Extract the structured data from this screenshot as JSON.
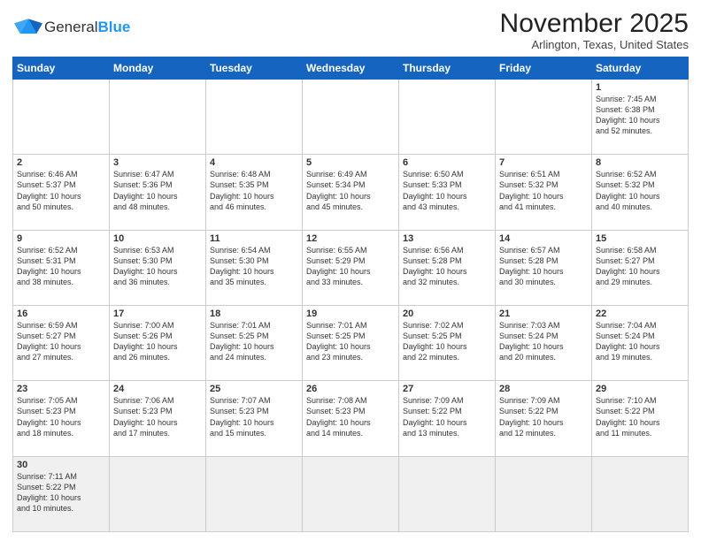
{
  "header": {
    "logo_general": "General",
    "logo_blue": "Blue",
    "title": "November 2025",
    "subtitle": "Arlington, Texas, United States"
  },
  "weekdays": [
    "Sunday",
    "Monday",
    "Tuesday",
    "Wednesday",
    "Thursday",
    "Friday",
    "Saturday"
  ],
  "weeks": [
    [
      {
        "day": "",
        "info": ""
      },
      {
        "day": "",
        "info": ""
      },
      {
        "day": "",
        "info": ""
      },
      {
        "day": "",
        "info": ""
      },
      {
        "day": "",
        "info": ""
      },
      {
        "day": "",
        "info": ""
      },
      {
        "day": "1",
        "info": "Sunrise: 7:45 AM\nSunset: 6:38 PM\nDaylight: 10 hours\nand 52 minutes."
      }
    ],
    [
      {
        "day": "2",
        "info": "Sunrise: 6:46 AM\nSunset: 5:37 PM\nDaylight: 10 hours\nand 50 minutes."
      },
      {
        "day": "3",
        "info": "Sunrise: 6:47 AM\nSunset: 5:36 PM\nDaylight: 10 hours\nand 48 minutes."
      },
      {
        "day": "4",
        "info": "Sunrise: 6:48 AM\nSunset: 5:35 PM\nDaylight: 10 hours\nand 46 minutes."
      },
      {
        "day": "5",
        "info": "Sunrise: 6:49 AM\nSunset: 5:34 PM\nDaylight: 10 hours\nand 45 minutes."
      },
      {
        "day": "6",
        "info": "Sunrise: 6:50 AM\nSunset: 5:33 PM\nDaylight: 10 hours\nand 43 minutes."
      },
      {
        "day": "7",
        "info": "Sunrise: 6:51 AM\nSunset: 5:32 PM\nDaylight: 10 hours\nand 41 minutes."
      },
      {
        "day": "8",
        "info": "Sunrise: 6:52 AM\nSunset: 5:32 PM\nDaylight: 10 hours\nand 40 minutes."
      }
    ],
    [
      {
        "day": "9",
        "info": "Sunrise: 6:52 AM\nSunset: 5:31 PM\nDaylight: 10 hours\nand 38 minutes."
      },
      {
        "day": "10",
        "info": "Sunrise: 6:53 AM\nSunset: 5:30 PM\nDaylight: 10 hours\nand 36 minutes."
      },
      {
        "day": "11",
        "info": "Sunrise: 6:54 AM\nSunset: 5:30 PM\nDaylight: 10 hours\nand 35 minutes."
      },
      {
        "day": "12",
        "info": "Sunrise: 6:55 AM\nSunset: 5:29 PM\nDaylight: 10 hours\nand 33 minutes."
      },
      {
        "day": "13",
        "info": "Sunrise: 6:56 AM\nSunset: 5:28 PM\nDaylight: 10 hours\nand 32 minutes."
      },
      {
        "day": "14",
        "info": "Sunrise: 6:57 AM\nSunset: 5:28 PM\nDaylight: 10 hours\nand 30 minutes."
      },
      {
        "day": "15",
        "info": "Sunrise: 6:58 AM\nSunset: 5:27 PM\nDaylight: 10 hours\nand 29 minutes."
      }
    ],
    [
      {
        "day": "16",
        "info": "Sunrise: 6:59 AM\nSunset: 5:27 PM\nDaylight: 10 hours\nand 27 minutes."
      },
      {
        "day": "17",
        "info": "Sunrise: 7:00 AM\nSunset: 5:26 PM\nDaylight: 10 hours\nand 26 minutes."
      },
      {
        "day": "18",
        "info": "Sunrise: 7:01 AM\nSunset: 5:25 PM\nDaylight: 10 hours\nand 24 minutes."
      },
      {
        "day": "19",
        "info": "Sunrise: 7:01 AM\nSunset: 5:25 PM\nDaylight: 10 hours\nand 23 minutes."
      },
      {
        "day": "20",
        "info": "Sunrise: 7:02 AM\nSunset: 5:25 PM\nDaylight: 10 hours\nand 22 minutes."
      },
      {
        "day": "21",
        "info": "Sunrise: 7:03 AM\nSunset: 5:24 PM\nDaylight: 10 hours\nand 20 minutes."
      },
      {
        "day": "22",
        "info": "Sunrise: 7:04 AM\nSunset: 5:24 PM\nDaylight: 10 hours\nand 19 minutes."
      }
    ],
    [
      {
        "day": "23",
        "info": "Sunrise: 7:05 AM\nSunset: 5:23 PM\nDaylight: 10 hours\nand 18 minutes."
      },
      {
        "day": "24",
        "info": "Sunrise: 7:06 AM\nSunset: 5:23 PM\nDaylight: 10 hours\nand 17 minutes."
      },
      {
        "day": "25",
        "info": "Sunrise: 7:07 AM\nSunset: 5:23 PM\nDaylight: 10 hours\nand 15 minutes."
      },
      {
        "day": "26",
        "info": "Sunrise: 7:08 AM\nSunset: 5:23 PM\nDaylight: 10 hours\nand 14 minutes."
      },
      {
        "day": "27",
        "info": "Sunrise: 7:09 AM\nSunset: 5:22 PM\nDaylight: 10 hours\nand 13 minutes."
      },
      {
        "day": "28",
        "info": "Sunrise: 7:09 AM\nSunset: 5:22 PM\nDaylight: 10 hours\nand 12 minutes."
      },
      {
        "day": "29",
        "info": "Sunrise: 7:10 AM\nSunset: 5:22 PM\nDaylight: 10 hours\nand 11 minutes."
      }
    ],
    [
      {
        "day": "30",
        "info": "Sunrise: 7:11 AM\nSunset: 5:22 PM\nDaylight: 10 hours\nand 10 minutes."
      },
      {
        "day": "",
        "info": ""
      },
      {
        "day": "",
        "info": ""
      },
      {
        "day": "",
        "info": ""
      },
      {
        "day": "",
        "info": ""
      },
      {
        "day": "",
        "info": ""
      },
      {
        "day": "",
        "info": ""
      }
    ]
  ]
}
